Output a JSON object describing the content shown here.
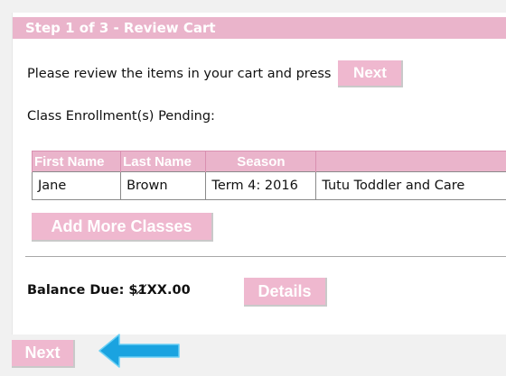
{
  "header": {
    "title": "Step 1 of 3 - Review Cart"
  },
  "intro": {
    "text": "Please review the items in your cart and press",
    "next_label": "Next"
  },
  "pending_label": "Class Enrollment(s) Pending:",
  "table": {
    "headers": [
      "First Name",
      "Last Name",
      "Season",
      ""
    ],
    "rows": [
      {
        "first": "Jane",
        "last": "Brown",
        "season": "Term 4: 2016",
        "class": "Tutu Toddler and Care"
      }
    ]
  },
  "add_more_label": "Add More Classes",
  "balance": {
    "label": "Balance Due: $",
    "amount": "1̸XX.00"
  },
  "details_label": "Details",
  "bottom_next_label": "Next",
  "colors": {
    "accent_pink": "#eab4cb",
    "arrow_blue": "#1aa3e0"
  },
  "icons": {
    "pointer": "arrow-left-icon"
  }
}
